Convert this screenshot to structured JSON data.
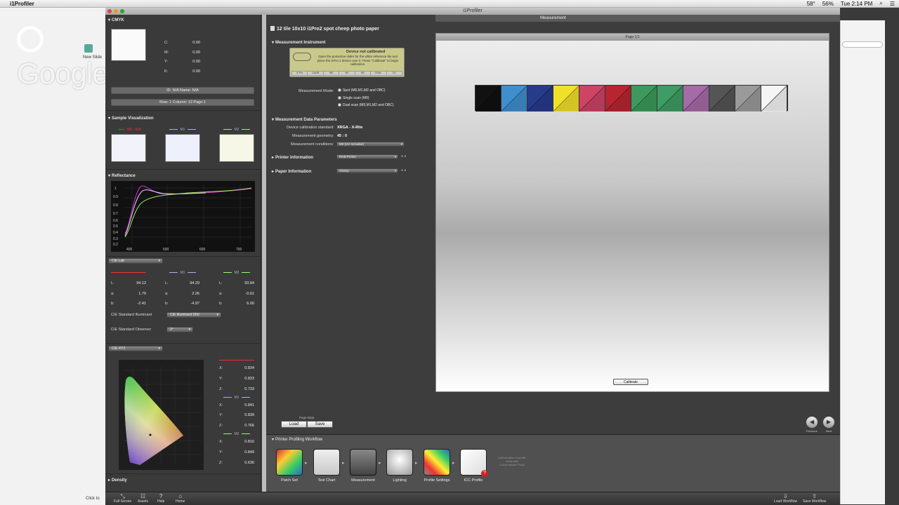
{
  "menubar": {
    "app_name": "i1Profiler",
    "clock": "Tue 2:14 PM",
    "battery": "56%",
    "temp": "58°"
  },
  "background_app": {
    "google_plus": "Google+",
    "new_slide": "New Slide",
    "click_to": "Click to"
  },
  "window": {
    "title": "i1Profiler",
    "doc_header": "Measurement"
  },
  "left_panel": {
    "cmyk_title": "CMYK",
    "cmyk": [
      {
        "label": "C:",
        "value": "0.00"
      },
      {
        "label": "M:",
        "value": "0.00"
      },
      {
        "label": "Y:",
        "value": "0.00"
      },
      {
        "label": "K:",
        "value": "0.00"
      }
    ],
    "id_pill": "ID: N/A   Name: N/A",
    "row_pill": "Row: 1   Column: 12   Page:1",
    "sample_vis_title": "Sample Visualization",
    "legend": [
      "M0 - N/A",
      "M1",
      "M2"
    ],
    "reflectance_title": "Reflectance",
    "refl_yticks": [
      "1",
      "0.9",
      "0.8",
      "0.7",
      "0.6",
      "0.5",
      "0.4",
      "0.3",
      "0.2"
    ],
    "refl_xticks": [
      "400",
      "500",
      "600",
      "700"
    ],
    "cie_lab_dd": "CIE Lab",
    "lab": [
      {
        "col": "M0",
        "L": "94.12",
        "a": "1.79",
        "b": "-2.41"
      },
      {
        "col": "M1",
        "L": "94.29",
        "a": "2.26",
        "b": "-4.97"
      },
      {
        "col": "M2",
        "L": "93.84",
        "a": "-0.61",
        "b": "6.00"
      }
    ],
    "lab_labels": {
      "L": "L:",
      "a": "a:",
      "b": "b:"
    },
    "illuminant_label": "CIE Standard Illuminant",
    "illuminant_value": "CIE Illuminant D50",
    "observer_label": "CIE Standard Observer",
    "observer_value": "2°",
    "cie_xyz_dd": "CIE XYZ",
    "xyz": [
      {
        "col": "M0",
        "X": "0.834",
        "Y": "0.833",
        "Z": "0.733"
      },
      {
        "col": "M1",
        "X": "0.841",
        "Y": "0.839",
        "Z": "0.766"
      },
      {
        "col": "M2",
        "X": "0.816",
        "Y": "0.849",
        "Z": "0.636"
      }
    ],
    "xyz_labels": {
      "X": "X:",
      "Y": "Y:",
      "Z": "Z:"
    },
    "density_title": "Density"
  },
  "bottom_bar": {
    "full_screen": "Full Screen",
    "assets": "Assets",
    "help": "Help",
    "home": "Home",
    "load_workflow": "Load Workflow",
    "save_workflow": "Save Workflow"
  },
  "middle": {
    "doc_title": "12 tile 10x10 i1Pro2 spot cheep photo paper",
    "instrument_title": "Measurement Instrument",
    "device_status": "Device not calibrated",
    "device_msg": "Open the protective slider for the white reference tile and place the i1Pro 2 device over it. Press \"Calibrate\" to begin calibration.",
    "device_bar": [
      "i1 Pro",
      "CALIB",
      "M0",
      "M1",
      "M2",
      "DUAL",
      "1/1"
    ],
    "mode_label": "Measurement Mode:",
    "modes": [
      "Spot (M0,M1,M2 and OBC)",
      "Single scan (M0)",
      "Dual scan (M0,M1,M2 and OBC)"
    ],
    "params_title": "Measurement Data Parameters",
    "calib_std_label": "Device calibration standard:",
    "calib_std_value": "XRGA - X-Rite",
    "geometry_label": "Measurement geometry:",
    "geometry_value": "45 : 0",
    "conditions_label": "Measurement conditions:",
    "conditions_value": "M0 (UV Included)",
    "printer_info_label": "Printer Information",
    "printer_info_value": "RGB Printer",
    "paper_info_label": "Paper Information",
    "paper_info_value": "Glossy"
  },
  "page": {
    "bar_label": "Page 1/1",
    "calibrate": "Calibrate"
  },
  "patches": [
    "#111111",
    "#3f8fcf",
    "#273b8c",
    "#f1e02a",
    "#cc4466",
    "#b82530",
    "#3d9a5c",
    "#3f9c65",
    "#a56aa8",
    "#555555",
    "#9a9a9a",
    "#f5f5f5"
  ],
  "page_data": {
    "label": "Page Data",
    "load": "Load",
    "save": "Save",
    "previous": "Previous",
    "next": "Next"
  },
  "workflow": {
    "title": "Printer Profiling Workflow",
    "steps": [
      "Patch Set",
      "Test Chart",
      "Measurement",
      "Lighting",
      "Profile Settings",
      "ICC Profile"
    ],
    "note": "Until iterative of profile verify with ColorChecker Proof"
  }
}
